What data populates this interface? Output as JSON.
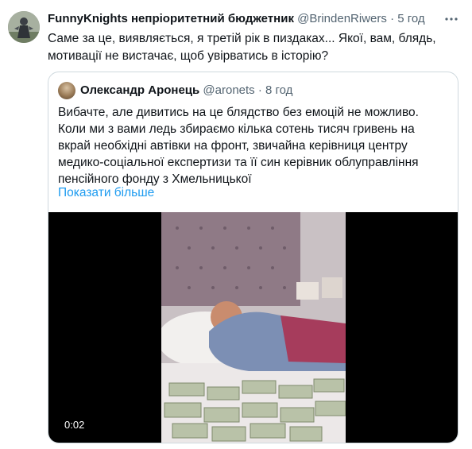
{
  "tweet": {
    "display_name": "FunnyKnights непріоритетний бюджетник",
    "handle": "@BrindenRiwers",
    "separator": "·",
    "time": "5 год",
    "text": "Саме за це, виявляється, я третій рік в пиздаках... Якої, вам, блядь, мотивації не вистачає, щоб увірватись в історію?",
    "more_icon": "more-horizontal-icon"
  },
  "quote": {
    "display_name": "Олександр Аронець",
    "handle": "@aronets",
    "separator": "·",
    "time": "8 год",
    "text": "Вибачте, але дивитись на це блядство без емоцій не можливо. Коли ми з вами ледь збираємо кілька сотень тисяч гривень на вкрай необхідні автівки на фронт, звичайна керівниця центру медико-соціальної експертизи та її син керівник облуправління пенсійного фонду з Хмельницької",
    "show_more": "Показати більше",
    "video_duration": "0:02"
  },
  "colors": {
    "link": "#1d9bf0",
    "secondary_text": "#536471",
    "border": "#cfd9de",
    "media_bg": "#000000"
  }
}
